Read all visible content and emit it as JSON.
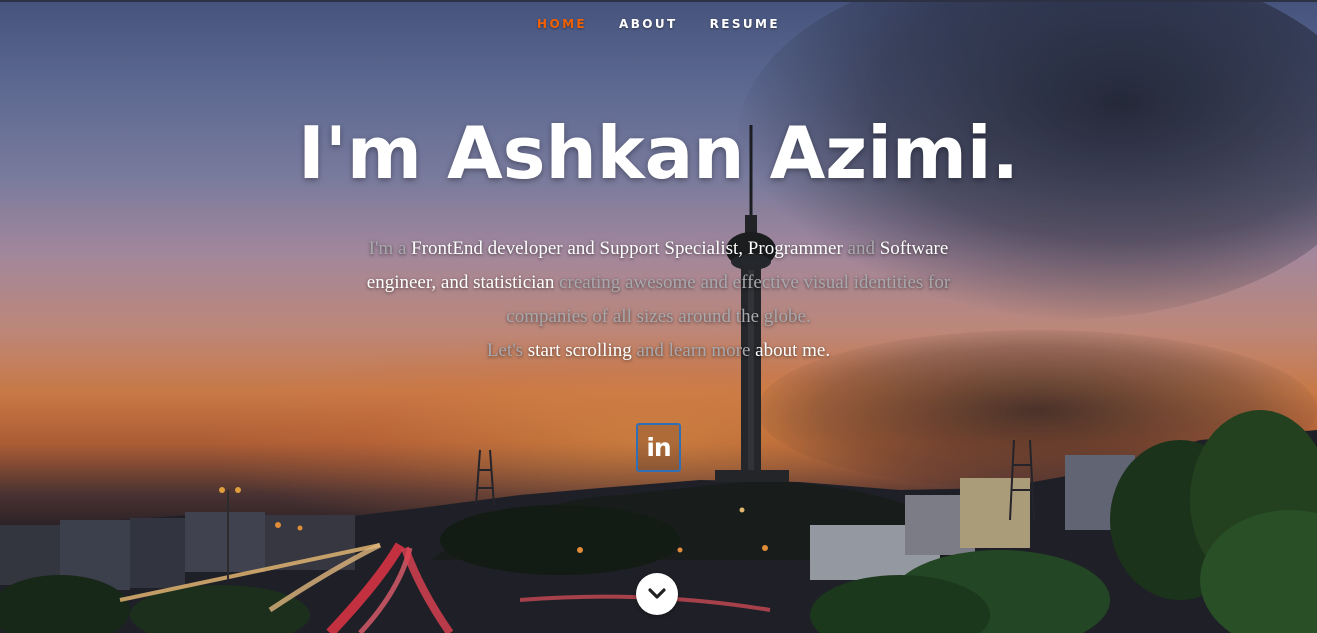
{
  "nav": {
    "items": [
      {
        "label": "HOME",
        "active": true
      },
      {
        "label": "ABOUT",
        "active": false
      },
      {
        "label": "RESUME",
        "active": false
      }
    ]
  },
  "hero": {
    "headline": "I'm Ashkan Azimi.",
    "intro": {
      "line1_a": "I'm a ",
      "line1_b": "FrontEnd developer and Support Specialist, Programmer",
      "line1_c": " and ",
      "line1_d": "Software",
      "line2_a": "engineer, and statistician",
      "line2_b": " creating awesome and effective visual identities for",
      "line3": "companies of all sizes around the globe.",
      "line4_a": "Let's ",
      "line4_b": "start scrolling",
      "line4_c": " and learn more ",
      "line4_d": "about me."
    },
    "social": {
      "label": "in",
      "icon": "linkedin-icon"
    },
    "scroll_icon": "chevron-down-icon"
  },
  "colors": {
    "accent": "#f06000",
    "linkedin_border": "#2f6fb5",
    "text_primary": "#ffffff",
    "text_muted": "#a8a8ad"
  }
}
